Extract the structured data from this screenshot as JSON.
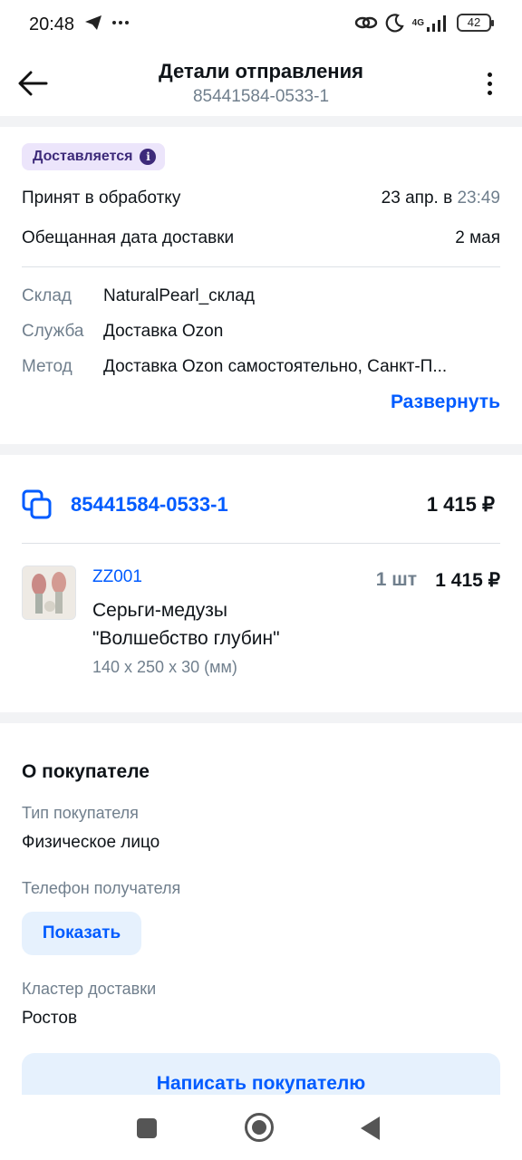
{
  "status_bar": {
    "time": "20:48",
    "network": "4G",
    "battery": "42",
    "left_icons": [
      "telegram-icon",
      "more-dots-icon"
    ],
    "right_icons": [
      "link-icon",
      "moon-icon",
      "signal-icon",
      "battery-icon"
    ]
  },
  "header": {
    "title": "Детали отправления",
    "subtitle": "85441584-0533-1"
  },
  "shipment": {
    "status_badge": "Доставляется",
    "accepted_label": "Принят в обработку",
    "accepted_date": "23 апр. в",
    "accepted_time": "23:49",
    "promised_label": "Обещанная дата доставки",
    "promised_date": "2 мая",
    "details": [
      {
        "key": "Склад",
        "value": "NaturalPearl_склад"
      },
      {
        "key": "Служба",
        "value": "Доставка Ozon"
      },
      {
        "key": "Метод",
        "value": "Доставка Ozon самостоятельно, Санкт-П..."
      }
    ],
    "expand_label": "Развернуть"
  },
  "posting": {
    "number": "85441584-0533-1",
    "total": "1 415 ₽",
    "item": {
      "sku": "ZZ001",
      "name_line1": "Серьги-медузы",
      "name_line2": "\"Волшебство глубин\"",
      "dimensions": "140 x 250 x 30 (мм)",
      "quantity": "1 шт",
      "price": "1 415 ₽"
    }
  },
  "buyer": {
    "section_title": "О покупателе",
    "type_label": "Тип покупателя",
    "type_value": "Физическое лицо",
    "phone_label": "Телефон получателя",
    "show_button": "Показать",
    "cluster_label": "Кластер доставки",
    "cluster_value": "Ростов",
    "write_button": "Написать покупателю"
  },
  "colors": {
    "accent": "#005bff",
    "badge_bg": "#ece5fb",
    "badge_text": "#3d2a7a",
    "muted": "#707f8d",
    "button_bg": "#e6f1fd"
  }
}
